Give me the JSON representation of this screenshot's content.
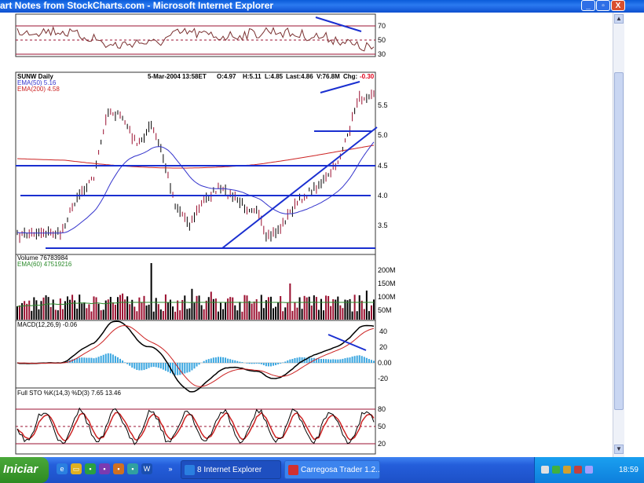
{
  "window": {
    "title": "art Notes from StockCharts.com - Microsoft Internet Explorer",
    "buttons": [
      "_",
      "▫",
      "X"
    ]
  },
  "chart_header": {
    "symbol_label": "SUNW Daily",
    "date_line": "5-Mar-2004 13:58ET",
    "open": "O:4.97",
    "high": "H:5.11",
    "low": "L:4.85",
    "last": "Last:4.86",
    "volume": "V:76.8M",
    "change_label": "Chg:",
    "change_value": "-0.30",
    "ema50": "EMA(50) 5.16",
    "ema200": "EMA(200) 4.58"
  },
  "panels": {
    "rsi": {
      "ticks": [
        "70",
        "50",
        "30"
      ]
    },
    "price": {
      "ticks": [
        "5.5",
        "5.0",
        "4.5",
        "4.0",
        "3.5"
      ]
    },
    "volume": {
      "label": "Volume 76783984",
      "ema_label": "EMA(60) 47519216",
      "ticks": [
        "200M",
        "150M",
        "100M",
        "50M"
      ]
    },
    "macd": {
      "label": "MACD(12,26,9) -0.06",
      "ticks": [
        "40",
        "20",
        "0.00",
        "-20"
      ]
    },
    "sto": {
      "label": "Full STO %K(14,3) %D(3) 7.65  13.46",
      "ticks": [
        "80",
        "50",
        "20"
      ]
    }
  },
  "colors": {
    "ema50": "#3333cc",
    "ema200": "#cc2222",
    "trendline": "#1a2fd0",
    "volume_bar": "#9b1030",
    "macd_hist": "#3aa6e0",
    "change_negative": "#e0001a"
  },
  "taskbar": {
    "start_label": "Iniciar",
    "tasks": [
      "8 Internet Explorer",
      "Carregosa Trader 1.2..."
    ],
    "clock": "18:59"
  }
}
